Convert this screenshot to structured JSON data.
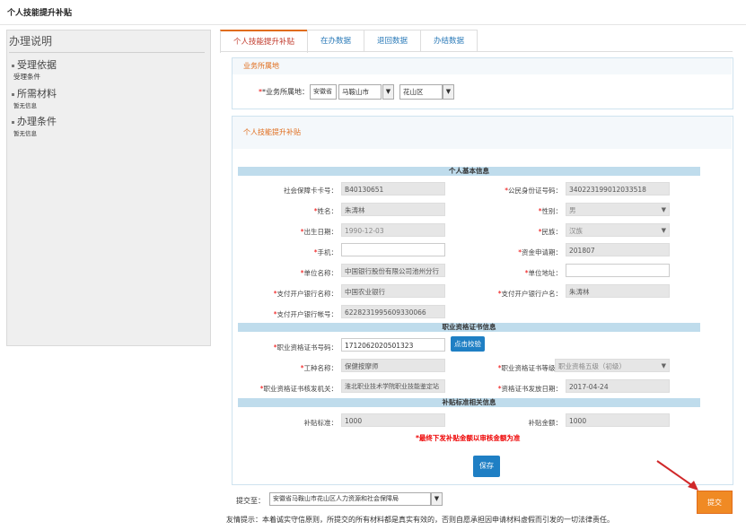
{
  "page": {
    "title": "个人技能提升补贴"
  },
  "sidebar": {
    "heading": "办理说明",
    "sections": [
      {
        "title": "受理依据",
        "sub": "受理条件"
      },
      {
        "title": "所需材料",
        "sub": "暂无信息"
      },
      {
        "title": "办理条件",
        "sub": "暂无信息"
      }
    ]
  },
  "tabs": [
    {
      "label": "个人技能提升补贴",
      "active": true
    },
    {
      "label": "在办数据",
      "active": false
    },
    {
      "label": "退回数据",
      "active": false
    },
    {
      "label": "办结数据",
      "active": false
    }
  ],
  "region": {
    "header": "业务所属地",
    "label": "*业务所属地：",
    "province": "安徽省",
    "city": "马鞍山市",
    "district": "花山区"
  },
  "form": {
    "header": "个人技能提升补贴",
    "basic": {
      "title": "个人基本信息",
      "si_card_label": "社会保障卡卡号：",
      "si_card": "B40130651",
      "id_label": "公民身份证号码：",
      "id": "340223199012033518",
      "name_label": "姓名：",
      "name": "朱涛林",
      "gender_label": "性别：",
      "gender": "男",
      "birth_label": "出生日期：",
      "birth": "1990-12-03",
      "ethnic_label": "民族：",
      "ethnic": "汉族",
      "phone_label": "手机：",
      "phone": "",
      "fund_month_label": "资金申请期：",
      "fund_month": "201807",
      "employer_label": "单位名称：",
      "employer": "中国银行股份有限公司池州分行",
      "address_label": "单位地址：",
      "address": "",
      "bank_label": "支付开户银行名称：",
      "bank": "中国农业银行",
      "account_name_label": "支付开户银行户名：",
      "account_name": "朱涛林",
      "account_no_label": "支付开户银行帐号：",
      "account_no": "6228231995609330066"
    },
    "cert": {
      "title": "职业资格证书信息",
      "number_label": "职业资格证书号码：",
      "number": "1712062020501323",
      "verify_button": "点击校验",
      "job_label": "工种名称：",
      "job": "保健按摩师",
      "level_label": "职业资格证书等级：",
      "level": "职业资格五级（初级）",
      "issuer_label": "职业资格证书核发机关：",
      "issuer": "淮北职业技术学院职业技能鉴定站",
      "issue_date_label": "资格证书发放日期：",
      "issue_date": "2017-04-24"
    },
    "subsidy": {
      "title": "补贴标准相关信息",
      "standard_label": "补贴标准：",
      "standard": "1000",
      "amount_label": "补贴金额：",
      "amount": "1000",
      "note": "*最终下发补贴金额以审核金额为准"
    },
    "save_button": "保存"
  },
  "submit": {
    "to_label": "提交至：",
    "to_value": "安徽省马鞍山市花山区人力资源和社会保障局",
    "button": "提交",
    "tip": "友情提示：本着诚实守信原则，所提交的所有材料都是真实有效的，否则自愿承担因申请材料虚假而引发的一切法律责任。"
  },
  "colors": {
    "accent": "#e06c1b",
    "primary": "#1f7fc4",
    "section_bar": "#bfdcec",
    "arrow": "#d0282a"
  }
}
